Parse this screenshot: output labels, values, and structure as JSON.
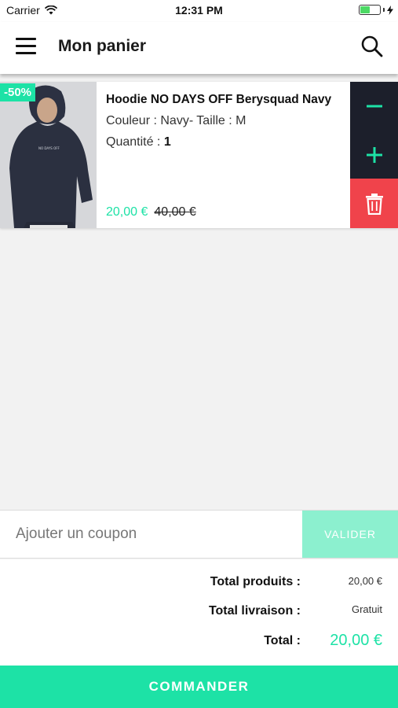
{
  "status_bar": {
    "carrier": "Carrier",
    "time": "12:31 PM",
    "battery_level": 0.5
  },
  "header": {
    "title": "Mon panier"
  },
  "cart": {
    "items": [
      {
        "discount": "-50%",
        "name": "Hoodie NO DAYS OFF Berysquad Navy",
        "variant": "Couleur : Navy- Taille : M",
        "quantity_label": "Quantité :",
        "quantity": "1",
        "price": "20,00 €",
        "old_price": "40,00 €"
      }
    ]
  },
  "coupon": {
    "placeholder": "Ajouter un coupon",
    "button": "VALIDER"
  },
  "totals": {
    "products_label": "Total produits :",
    "products_value": "20,00 €",
    "shipping_label": "Total livraison :",
    "shipping_value": "Gratuit",
    "total_label": "Total :",
    "total_value": "20,00 €"
  },
  "checkout": {
    "label": "COMMANDER"
  },
  "colors": {
    "accent": "#1de2a6",
    "dark": "#1c1f2b",
    "danger": "#f0434b"
  },
  "icons": [
    "menu-icon",
    "search-icon",
    "minus-icon",
    "plus-icon",
    "trash-icon",
    "wifi-icon",
    "battery-icon"
  ]
}
